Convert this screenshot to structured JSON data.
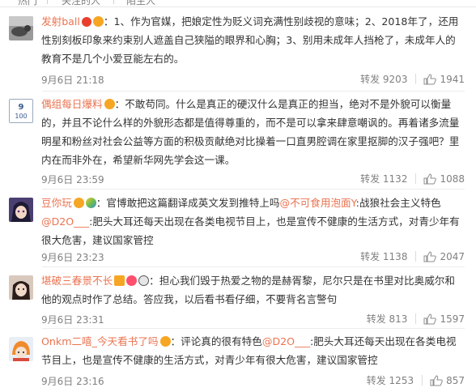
{
  "tabs": [
    {
      "label": "热门"
    },
    {
      "label": "关注的人"
    },
    {
      "label": "陌生人"
    }
  ],
  "comments": [
    {
      "username": "发射ball",
      "text": "：1、作为官媒，把娘定性为贬义词充满性别歧视的意味；2、2018年了，还用性别刻板印象来约束别人遮盖自己狭隘的眼界和心胸；3、别用未成年人挡枪了，未成年人的教育不是几个小爱豆能左右的。",
      "time": "9月6日 21:18",
      "repost": "转发 9203",
      "likes": "1941"
    },
    {
      "username": "偶组每日爆料",
      "text": "：不敢苟同。什么是真正的硬汉什么是真正的担当，绝对不是外貌可以衡量的，并且不论什么样的外貌形态都是值得尊重的，而不是可以拿来肆意嘲讽的。再着诸多流量明星和粉丝对社会公益等方面的积极贡献绝对比操着一口直男腔调在家里抠脚的汉子强吧？里内在而非外在，希望新华网先学会这一课。",
      "time": "9月6日 23:59",
      "repost": "转发 1132",
      "likes": "1088"
    },
    {
      "username": "豆你玩",
      "text_before": "：官博敢把这篇翻译成英文发到推特上吗",
      "mention1": "@不可食用泡面Y",
      "text_mid": ":战狼社会主义特色",
      "mention2": "@D2O___",
      "text_after": ":肥头大耳还每天出现在各类电视节目上，也是宣传不健康的生活方式，对青少年有很大危害，建议国家管控",
      "time": "9月6日 23:23",
      "repost": "转发 1138",
      "likes": "2047"
    },
    {
      "username": "堪破三春景不长",
      "text": "：担心我们毁于热爱之物的是赫胥黎，尼尔只是在书里对比奥威尔和他的观点时作了总结。答应我，以后看书看仔细，不要背名言警句",
      "time": "9月6日 23:31",
      "repost": "转发 813",
      "likes": "1597"
    },
    {
      "username": "Onkm二嘻_今天看书了吗",
      "text_before": "：评论真的很有特色",
      "mention": "@D2O___",
      "text_after": ":肥头大耳还每天出现在各类电视节目上，也是宣传不健康的生活方式，对青少年有很大危害，建议国家管控",
      "time": "9月6日 23:16",
      "repost": "转发 1253",
      "likes": "857"
    }
  ]
}
